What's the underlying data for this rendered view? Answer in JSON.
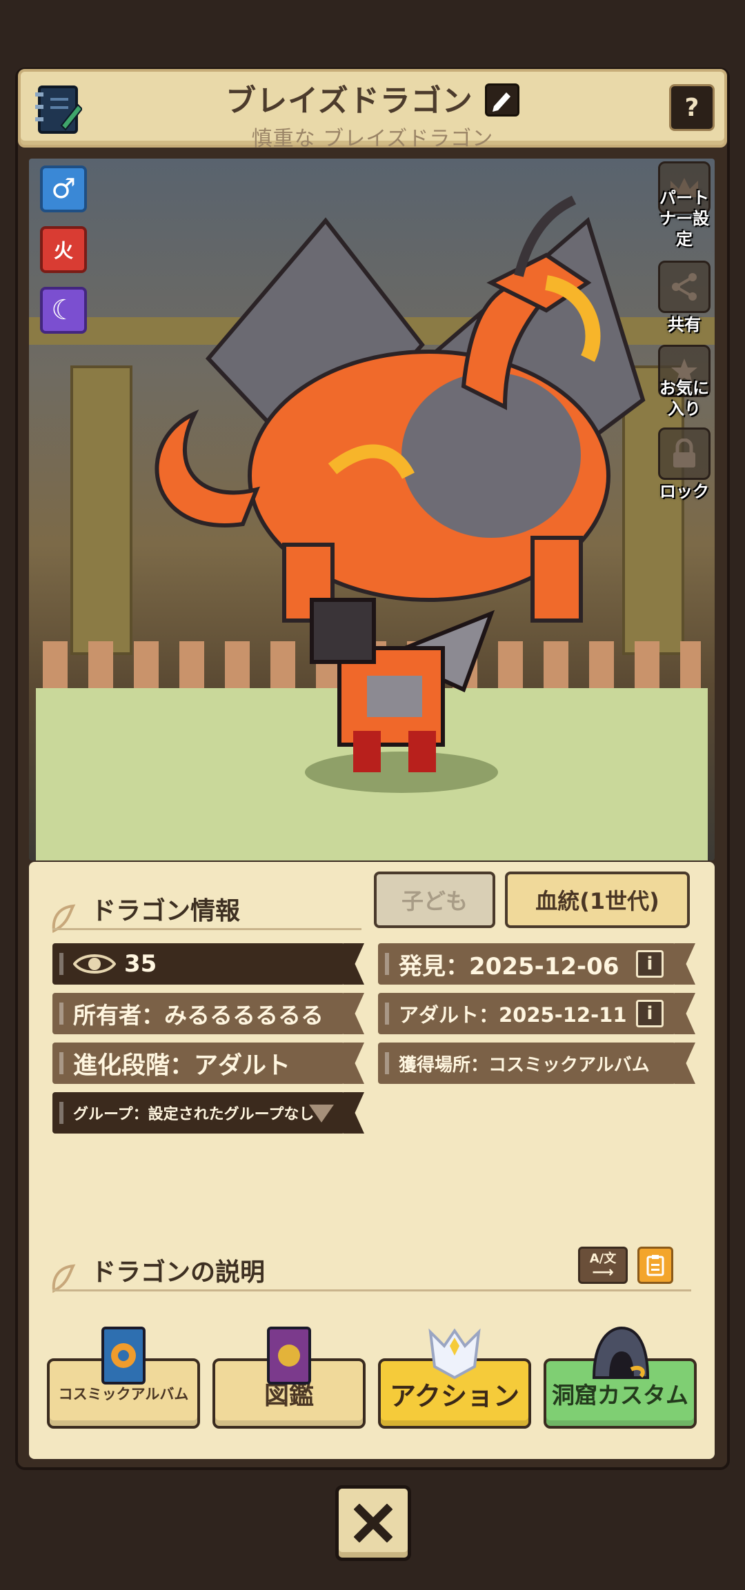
{
  "header": {
    "title": "ブレイズドラゴン",
    "subtitle": "慎重な ブレイズドラゴン",
    "help_label": "?"
  },
  "scene": {
    "badges": [
      {
        "name": "male-icon",
        "glyph": "♂",
        "color": "#3a88d6"
      },
      {
        "name": "fire-element-icon",
        "glyph": "火",
        "color": "#d93c33"
      },
      {
        "name": "moon-element-icon",
        "glyph": "☾",
        "color": "#7b4fd0"
      }
    ],
    "side_buttons": {
      "partner": "パート\nナー設\n定",
      "share": "共有",
      "favorite": "お気に\n入り",
      "lock": "ロック"
    }
  },
  "tabs": {
    "children": "子ども",
    "lineage": "血統(1世代)"
  },
  "info": {
    "section_title": "ドラゴン情報",
    "views": "35",
    "owner": "所有者：みるるるるるる",
    "stage": "進化段階：アダルト",
    "group": "グループ：設定されたグループなし",
    "discovered": "発見：2025-12-06",
    "adult": "アダルト：2025-12-11",
    "location": "獲得場所：コスミックアルバム"
  },
  "description": {
    "section_title": "ドラゴンの説明",
    "translate_label": "A/文"
  },
  "bottom_buttons": {
    "album": "コスミックアルバム",
    "encyclopedia": "図鑑",
    "action": "アクション",
    "cave": "洞窟カスタム"
  },
  "colors": {
    "panel": "#f3e7c1",
    "row_dark": "#3b2a1d",
    "row_mid": "#7b6147",
    "action_yellow": "#f5cb3a",
    "cave_green": "#7fcf73"
  }
}
